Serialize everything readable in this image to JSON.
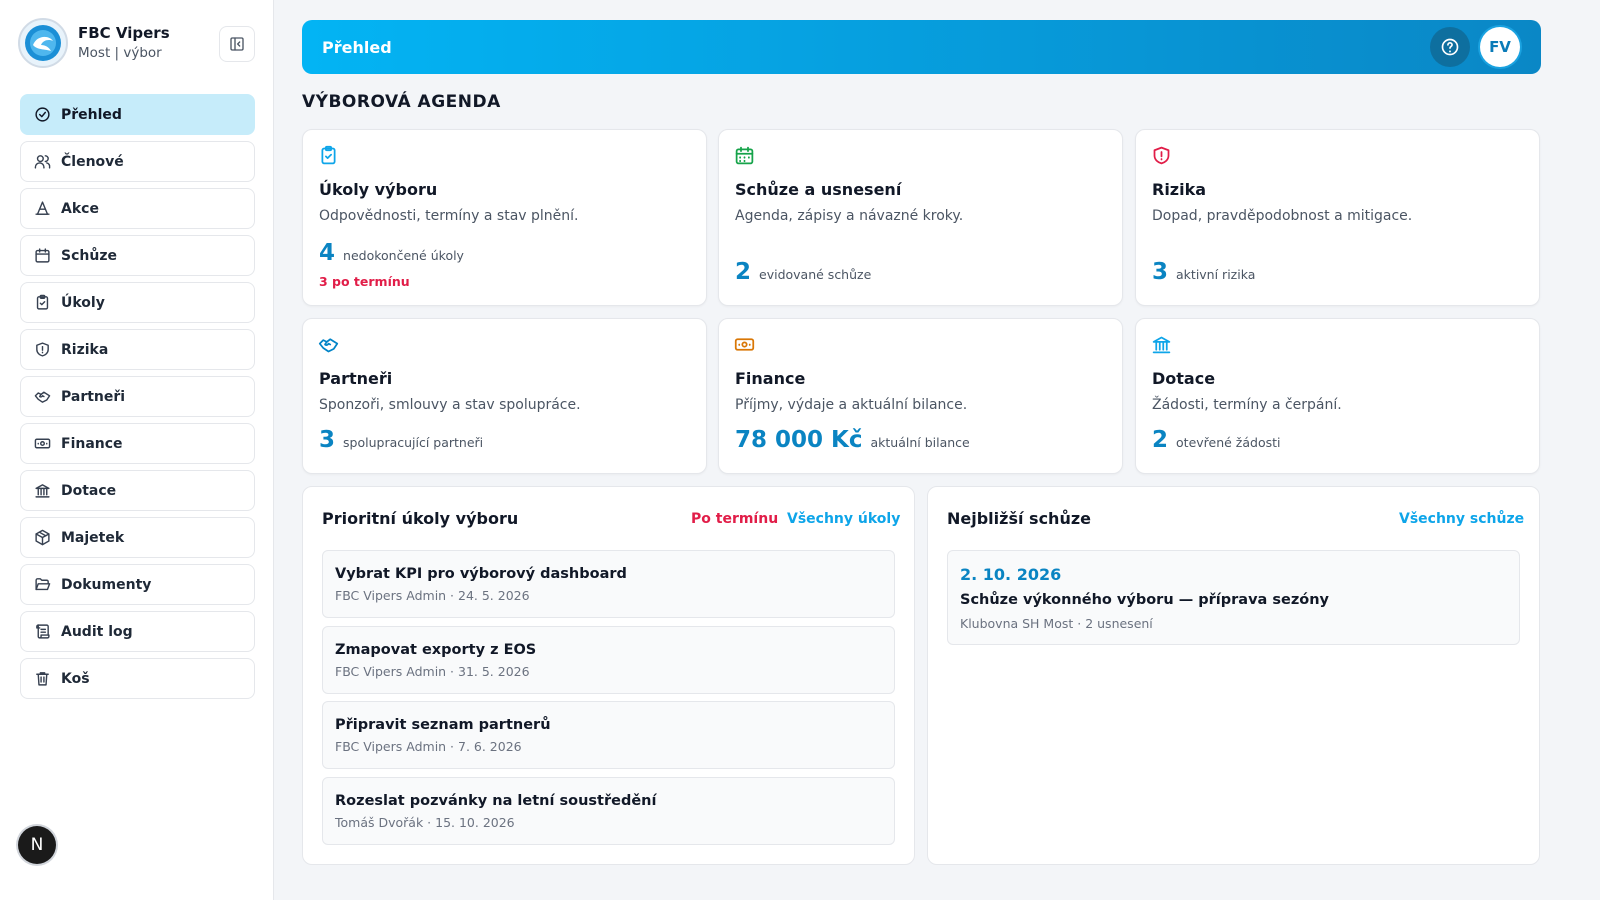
{
  "brand": {
    "name": "FBC Vipers",
    "subtitle": "Most | výbor"
  },
  "nav": [
    {
      "label": "Přehled",
      "icon": "check-circle-icon",
      "active": true
    },
    {
      "label": "Členové",
      "icon": "users-icon"
    },
    {
      "label": "Akce",
      "icon": "cone-icon"
    },
    {
      "label": "Schůze",
      "icon": "calendar-icon"
    },
    {
      "label": "Úkoly",
      "icon": "clipboard-check-icon"
    },
    {
      "label": "Rizika",
      "icon": "shield-alert-icon"
    },
    {
      "label": "Partneři",
      "icon": "handshake-icon"
    },
    {
      "label": "Finance",
      "icon": "banknote-icon"
    },
    {
      "label": "Dotace",
      "icon": "bank-icon"
    },
    {
      "label": "Majetek",
      "icon": "package-icon"
    },
    {
      "label": "Dokumenty",
      "icon": "folder-open-icon"
    },
    {
      "label": "Audit log",
      "icon": "scroll-icon"
    },
    {
      "label": "Koš",
      "icon": "trash-icon"
    }
  ],
  "header": {
    "title": "Přehled",
    "avatar": "FV",
    "help_icon": "help-circle-icon"
  },
  "section_title": "VÝBOROVÁ AGENDA",
  "cards": [
    {
      "title": "Úkoly výboru",
      "desc": "Odpovědnosti, termíny a stav plnění.",
      "value": "4",
      "label": "nedokončené úkoly",
      "note": "3 po termínu",
      "icon": "clipboard-check-icon",
      "color": "#0ea5e9"
    },
    {
      "title": "Schůze a usnesení",
      "desc": "Agenda, zápisy a návazné kroky.",
      "value": "2",
      "label": "evidované schůze",
      "icon": "calendar-icon",
      "color": "#16a34a"
    },
    {
      "title": "Rizika",
      "desc": "Dopad, pravděpodobnost a mitigace.",
      "value": "3",
      "label": "aktivní rizika",
      "icon": "shield-alert-icon",
      "color": "#e11d48"
    },
    {
      "title": "Partneři",
      "desc": "Sponzoři, smlouvy a stav spolupráce.",
      "value": "3",
      "label": "spolupracující partneři",
      "icon": "handshake-icon",
      "color": "#0284c7"
    },
    {
      "title": "Finance",
      "desc": "Příjmy, výdaje a aktuální bilance.",
      "value": "78 000 Kč",
      "label": "aktuální bilance",
      "icon": "banknote-icon",
      "color": "#d97706"
    },
    {
      "title": "Dotace",
      "desc": "Žádosti, termíny a čerpání.",
      "value": "2",
      "label": "otevřené žádosti",
      "icon": "bank-icon",
      "color": "#0ea5e9"
    }
  ],
  "tasks_panel": {
    "title": "Prioritní úkoly výboru",
    "link_overdue": "Po termínu",
    "link_all": "Všechny úkoly",
    "items": [
      {
        "title": "Vybrat KPI pro výborový dashboard",
        "meta": "FBC Vipers Admin · 24. 5. 2026"
      },
      {
        "title": "Zmapovat exporty z EOS",
        "meta": "FBC Vipers Admin · 31. 5. 2026"
      },
      {
        "title": "Připravit seznam partnerů",
        "meta": "FBC Vipers Admin · 7. 6. 2026"
      },
      {
        "title": "Rozeslat pozvánky na letní soustředění",
        "meta": "Tomáš Dvořák · 15. 10. 2026"
      }
    ]
  },
  "meetings_panel": {
    "title": "Nejbližší schůze",
    "link_all": "Všechny schůze",
    "meeting": {
      "date": "2. 10. 2026",
      "title": "Schůze výkonného výboru — příprava sezóny",
      "meta": "Klubovna SH Most · 2 usnesení"
    }
  },
  "dev_badge": "N",
  "colors": {
    "accent": "#0a84c2",
    "danger": "#e11d48",
    "active_nav": "#c6ecfa"
  }
}
